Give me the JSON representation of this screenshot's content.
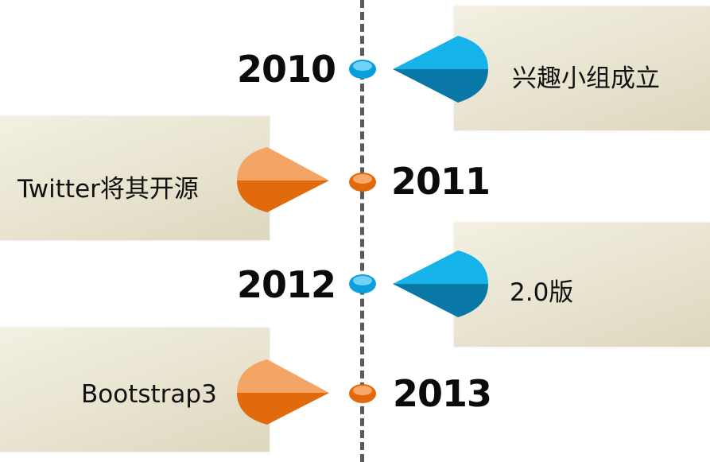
{
  "colors": {
    "blue_light": "#16b3ea",
    "blue_dark": "#0a78a6",
    "orange_light": "#f4a464",
    "orange_dark": "#e06a0c",
    "timeline": "#5a5a5a"
  },
  "events": [
    {
      "year": "2010",
      "text": "兴趣小组成立",
      "color": "blue"
    },
    {
      "year": "2011",
      "text": "Twitter将其开源",
      "color": "orange"
    },
    {
      "year": "2012",
      "text": "2.0版",
      "color": "blue"
    },
    {
      "year": "2013",
      "text": "Bootstrap3",
      "color": "orange"
    }
  ]
}
